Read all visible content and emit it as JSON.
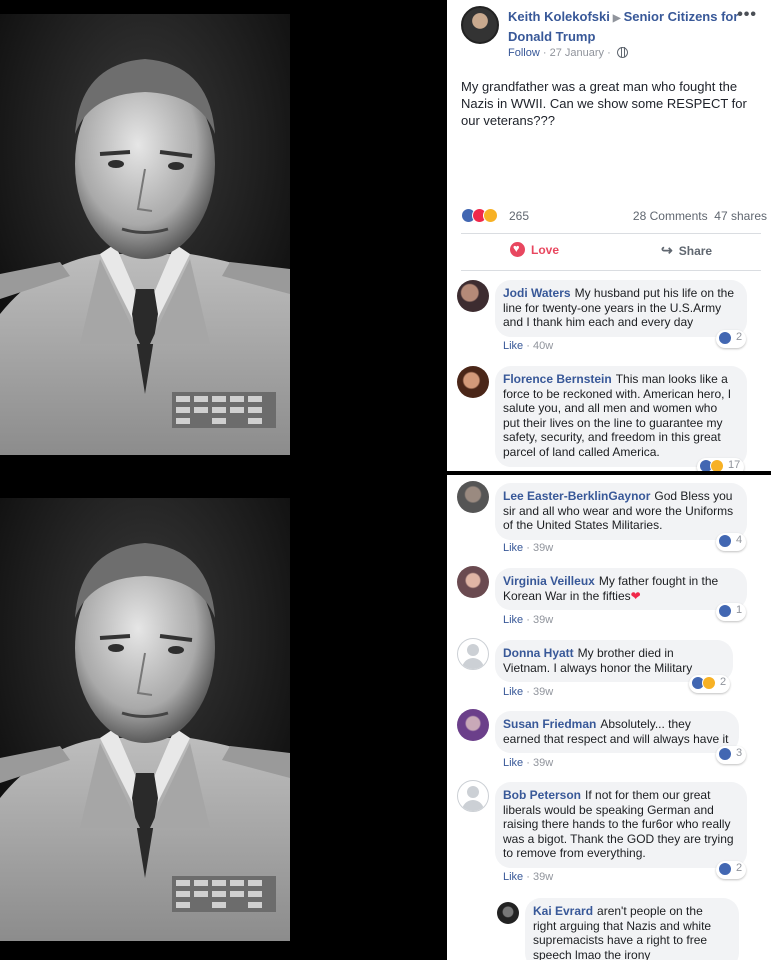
{
  "post": {
    "author": "Keith Kolekofski",
    "group": "Senior Citizens for Donald Trump",
    "follow": "Follow",
    "date": "27 January",
    "more": "•••",
    "text": "My grandfather was a great man who fought the Nazis in WWII. Can we show some RESPECT for our veterans???",
    "reaction_count": "265",
    "comments_count": "28 Comments",
    "shares_count": "47 shares",
    "love_label": "Love",
    "share_label": "Share"
  },
  "comments_top": [
    {
      "name": "Jodi Waters",
      "text": "My husband put his life on the line for twenty-one years in the U.S.Army and I thank him each and every day",
      "like": "Like",
      "time": "40w",
      "reactions": "2"
    },
    {
      "name": "Florence Bernstein",
      "text": "This man looks like a force to be reckoned with. American hero, I salute you, and all men and women who put their lives on the line to guarantee my safety, security, and freedom in this great parcel of land called America.",
      "like": "Like",
      "time": "",
      "reactions": "17"
    }
  ],
  "comments_bottom": [
    {
      "name": "Lee Easter-BerklinGaynor",
      "text": "God Bless you sir and all who wear and wore the Uniforms of the United States Militaries.",
      "like": "Like",
      "time": "39w",
      "reactions": "4"
    },
    {
      "name": "Virginia Veilleux",
      "text": "My father fought in the Korean War in the fifties",
      "like": "Like",
      "time": "39w",
      "reactions": "1"
    },
    {
      "name": "Donna Hyatt",
      "text": "My brother died in Vietnam. I always honor the Military",
      "like": "Like",
      "time": "39w",
      "reactions": "2"
    },
    {
      "name": "Susan Friedman",
      "text": "Absolutely... they earned that respect and will always have it",
      "like": "Like",
      "time": "39w",
      "reactions": "3"
    },
    {
      "name": "Bob Peterson",
      "text": "If not for them our great liberals would be speaking German and raising there hands to the fur6or who really was a bigot. Thank the GOD they are trying to remove from everything.",
      "like": "Like",
      "time": "39w",
      "reactions": "2"
    },
    {
      "name": "Kai Evrard",
      "text": "aren't people on the right arguing that Nazis and white supremacists have a right to free speech lmao the irony",
      "like": "",
      "time": "",
      "reactions": ""
    }
  ],
  "colors": {
    "link": "#385898",
    "like_blue": "#4267b2",
    "love_red": "#f0284a",
    "haha_yellow": "#f7b125",
    "bubble": "#f2f3f5"
  },
  "icons": [
    "globe-icon",
    "like-reaction-icon",
    "love-reaction-icon",
    "haha-reaction-icon",
    "heart-icon",
    "share-icon",
    "blank-avatar-icon"
  ]
}
